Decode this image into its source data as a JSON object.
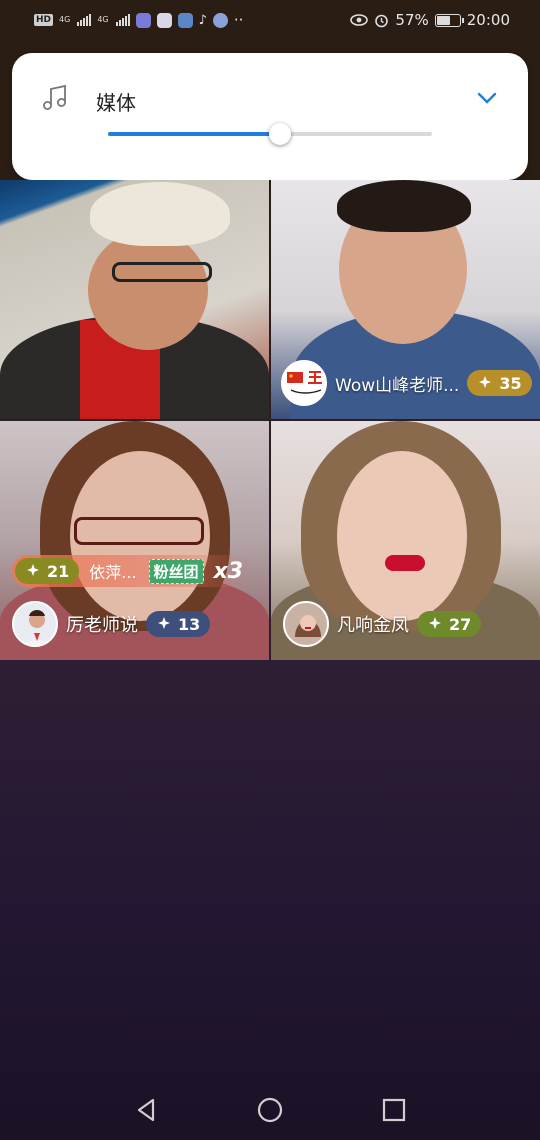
{
  "status_bar": {
    "left_chip": "HD",
    "sig1_tag": "4G",
    "sig2_tag": "4G",
    "more": "··",
    "battery": "57%",
    "time": "20:00"
  },
  "volume_panel": {
    "label": "媒体",
    "level": 0.53,
    "icon": "music-note-icon",
    "expand_icon": "chevron-down-icon",
    "accent": "#1f7fdf"
  },
  "tiles": [
    {
      "name": "",
      "score": ""
    },
    {
      "name": "Wow山峰老师...",
      "score": "35",
      "pill_color": "#b8902a"
    },
    {
      "name": "厉老师说",
      "score": "13",
      "pill_color": "#3d4f7a"
    },
    {
      "name": "凡响金凤",
      "score": "27",
      "pill_color": "#6e8a2a"
    }
  ],
  "gift": {
    "score": "21",
    "sender": "依萍...",
    "badge": "粉丝团",
    "multiplier": "x3"
  },
  "nav": {
    "back": "back-triangle-icon",
    "home": "home-circle-icon",
    "recents": "recents-square-icon"
  }
}
